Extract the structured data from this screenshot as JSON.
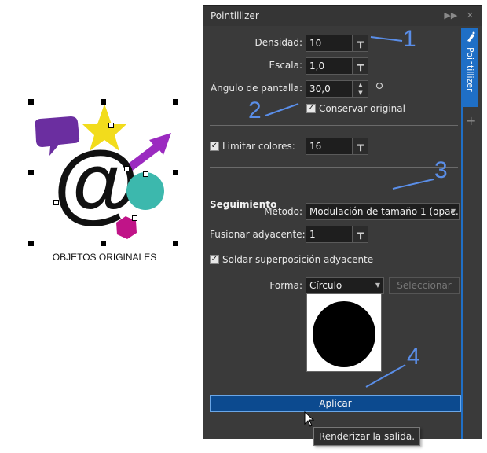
{
  "canvas": {
    "caption": "OBJETOS ORIGINALES",
    "colors": {
      "bubble": "#6b2ea0",
      "star": "#f2dc1c",
      "arrow": "#9b2ac0",
      "at": "#111111",
      "circle": "#3cb8ad",
      "hexagon": "#c01488"
    }
  },
  "docker": {
    "title": "Pointillizer",
    "header_icons": [
      "fast-forward-icon",
      "close-icon"
    ],
    "tab_label": "Pointillizer",
    "fields": {
      "densidad": {
        "label": "Densidad:",
        "value": "10"
      },
      "escala": {
        "label": "Escala:",
        "value": "1,0"
      },
      "angulo": {
        "label": "Ángulo de pantalla:",
        "value": "30,0"
      },
      "conservar": {
        "label": "Conservar original",
        "checked": true
      },
      "limitar": {
        "label": "Limitar colores:",
        "value": "16",
        "checked": true
      },
      "metodo": {
        "label": "Método:",
        "value": "Modulación de tamaño 1 (opac..."
      },
      "fusionar": {
        "label": "Fusionar adyacente:",
        "value": "1"
      },
      "soldar": {
        "label": "Soldar superposición adyacente",
        "checked": true
      },
      "forma": {
        "label": "Forma:",
        "value": "Círculo"
      }
    },
    "section_title": "Seguimiento",
    "seleccionar_label": "Seleccionar",
    "apply_label": "Aplicar",
    "tooltip": "Renderizar la salida.",
    "checkmark": "✓",
    "plus": "+",
    "accent_color": "#1f6fc6"
  },
  "annotations": [
    "1",
    "2",
    "3",
    "4"
  ]
}
